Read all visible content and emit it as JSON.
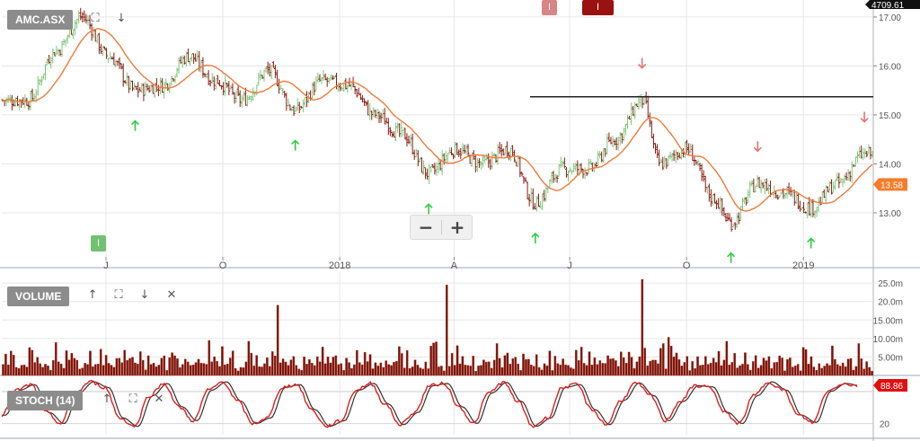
{
  "colors": {
    "up_candle": "#7cc77a",
    "down_candle": "#8a1a12",
    "ma_line": "#f07a3a",
    "resistance_line": "#222222",
    "volume_fill": "#6e1410",
    "volume_edge": "#c23a20",
    "stoch_k": "#e01e1e",
    "stoch_d": "#333333",
    "buy_arrow": "#2ecc40",
    "sell_arrow": "#e57373",
    "last_price_tag": "#f57c2a",
    "stoch_tag": "#e01010",
    "grid": "#e6e6e6"
  },
  "price_panel": {
    "label": "AMC.ASX",
    "top_right_value": "4709.61",
    "last_price": "13.58",
    "expand_icon": "expand-icon",
    "down_icon": "arrow-down-icon",
    "zoom_out": "−",
    "zoom_in": "+",
    "top_markers": [
      "I",
      "I"
    ],
    "event_marker": "I"
  },
  "volume_panel": {
    "label": "VOLUME",
    "icons": [
      "arrow-up-icon",
      "expand-icon",
      "arrow-down-icon",
      "close-icon"
    ]
  },
  "stoch_panel": {
    "label": "STOCH (14)",
    "last_value": "88.86",
    "icons": [
      "arrow-up-icon",
      "expand-icon",
      "close-icon"
    ]
  },
  "chart_data": [
    {
      "type": "candlestick",
      "title": "AMC.ASX",
      "x_tick_labels": [
        "J",
        "O",
        "2018",
        "A",
        "J",
        "O",
        "2019"
      ],
      "y_tick_labels": [
        "13.00",
        "14.00",
        "15.00",
        "16.00",
        "17.00"
      ],
      "ylim": [
        12.1,
        17.2
      ],
      "grid": true,
      "moving_average": true,
      "resistance_level": 15.37,
      "trend_points": [
        {
          "date": "2017-05-01",
          "close": 15.3
        },
        {
          "date": "2017-05-22",
          "close": 16.3
        },
        {
          "date": "2017-06-12",
          "close": 17.0
        },
        {
          "date": "2017-07-03",
          "close": 16.2
        },
        {
          "date": "2017-07-24",
          "close": 15.5
        },
        {
          "date": "2017-08-14",
          "close": 15.6
        },
        {
          "date": "2017-09-04",
          "close": 16.2
        },
        {
          "date": "2017-09-25",
          "close": 15.7
        },
        {
          "date": "2017-10-16",
          "close": 15.3
        },
        {
          "date": "2017-11-06",
          "close": 15.9
        },
        {
          "date": "2017-11-27",
          "close": 15.1
        },
        {
          "date": "2017-12-18",
          "close": 15.7
        },
        {
          "date": "2018-01-08",
          "close": 15.6
        },
        {
          "date": "2018-01-29",
          "close": 15.0
        },
        {
          "date": "2018-02-19",
          "close": 14.6
        },
        {
          "date": "2018-03-12",
          "close": 13.8
        },
        {
          "date": "2018-04-02",
          "close": 14.3
        },
        {
          "date": "2018-04-23",
          "close": 14.0
        },
        {
          "date": "2018-05-14",
          "close": 14.3
        },
        {
          "date": "2018-06-04",
          "close": 13.2
        },
        {
          "date": "2018-06-25",
          "close": 13.9
        },
        {
          "date": "2018-07-16",
          "close": 13.9
        },
        {
          "date": "2018-08-06",
          "close": 14.5
        },
        {
          "date": "2018-08-27",
          "close": 15.3
        },
        {
          "date": "2018-09-10",
          "close": 14.0
        },
        {
          "date": "2018-10-01",
          "close": 14.3
        },
        {
          "date": "2018-10-22",
          "close": 13.3
        },
        {
          "date": "2018-11-05",
          "close": 12.8
        },
        {
          "date": "2018-11-26",
          "close": 13.6
        },
        {
          "date": "2018-12-17",
          "close": 13.4
        },
        {
          "date": "2019-01-07",
          "close": 13.1
        },
        {
          "date": "2019-01-28",
          "close": 13.6
        },
        {
          "date": "2019-02-18",
          "close": 14.2
        }
      ]
    },
    {
      "type": "bar",
      "title": "VOLUME",
      "y_tick_labels": [
        "5.00m",
        "10.00m",
        "15.00m",
        "20.0m",
        "25.0m"
      ],
      "ylim": [
        0,
        26
      ],
      "unit": "millions",
      "typical_range": [
        1,
        9
      ],
      "spikes": [
        {
          "date": "2017-11-13",
          "value": 19
        },
        {
          "date": "2018-03-26",
          "value": 24.5
        },
        {
          "date": "2018-08-27",
          "value": 26
        }
      ]
    },
    {
      "type": "line",
      "title": "STOCH (14)",
      "y_tick_labels": [
        "20"
      ],
      "ylim": [
        0,
        100
      ],
      "series": [
        {
          "values": [
            35,
            80,
            90,
            40,
            20,
            75,
            95,
            85,
            30,
            15,
            70,
            92,
            50,
            25,
            80,
            95,
            60,
            20,
            30,
            85,
            90,
            45,
            15,
            25,
            80,
            92,
            55,
            18,
            40,
            88,
            92,
            50,
            20,
            75,
            94,
            60,
            15,
            30,
            85,
            90,
            45,
            18,
            62,
            93,
            70,
            25,
            60,
            88,
            86,
            40,
            20,
            70,
            95,
            80,
            35,
            22,
            78,
            92,
            88
          ]
        }
      ]
    }
  ]
}
